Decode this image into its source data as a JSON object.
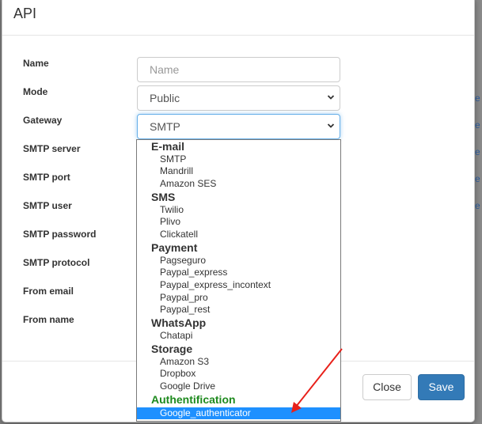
{
  "modal": {
    "title": "API"
  },
  "form": {
    "name": {
      "label": "Name",
      "placeholder": "Name"
    },
    "mode": {
      "label": "Mode",
      "value": "Public"
    },
    "gateway": {
      "label": "Gateway",
      "value": "SMTP"
    },
    "smtp_server": {
      "label": "SMTP server"
    },
    "smtp_port": {
      "label": "SMTP port"
    },
    "smtp_user": {
      "label": "SMTP user"
    },
    "smtp_password": {
      "label": "SMTP password"
    },
    "smtp_protocol": {
      "label": "SMTP protocol"
    },
    "from_email": {
      "label": "From email"
    },
    "from_name": {
      "label": "From name"
    }
  },
  "dropdown": {
    "groups": [
      {
        "label": "E-mail",
        "options": [
          "SMTP",
          "Mandrill",
          "Amazon SES"
        ]
      },
      {
        "label": "SMS",
        "options": [
          "Twilio",
          "Plivo",
          "Clickatell"
        ]
      },
      {
        "label": "Payment",
        "options": [
          "Pagseguro",
          "Paypal_express",
          "Paypal_express_incontext",
          "Paypal_pro",
          "Paypal_rest"
        ]
      },
      {
        "label": "WhatsApp",
        "options": [
          "Chatapi"
        ]
      },
      {
        "label": "Storage",
        "options": [
          "Amazon S3",
          "Dropbox",
          "Google Drive"
        ]
      },
      {
        "label": "Authentification",
        "options": [
          "Google_authenticator"
        ]
      }
    ],
    "highlighted": "Google_authenticator",
    "authentification_color": "#1e8a1e"
  },
  "footer": {
    "close_label": "Close",
    "save_label": "Save"
  },
  "background": {
    "link_fragments": [
      "e",
      "e",
      "e",
      "e",
      "e"
    ]
  },
  "colors": {
    "primary": "#337ab7",
    "annotation_arrow": "#e8201a"
  },
  "icons": {
    "select_chevron": "chevron-down-icon"
  }
}
